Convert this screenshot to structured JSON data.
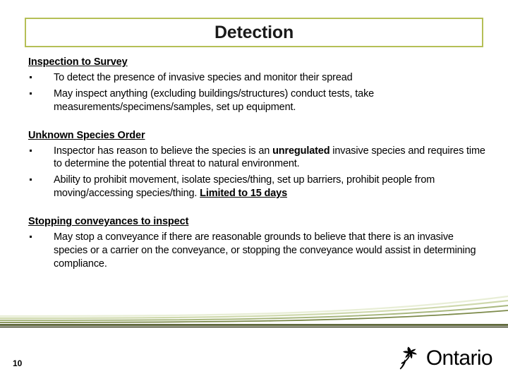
{
  "slide": {
    "title": "Detection",
    "page_number": "10",
    "accent_border_color": "#b5bf56",
    "title_color": "#1a1a1a"
  },
  "sections": [
    {
      "heading": "Inspection to Survey",
      "bullets": [
        {
          "parts": [
            {
              "text": "To detect the presence of invasive species and monitor their spread",
              "style": "normal"
            }
          ]
        },
        {
          "parts": [
            {
              "text": "May inspect anything (excluding buildings/structures) conduct tests, take measurements/specimens/samples, set up equipment.",
              "style": "normal"
            }
          ]
        }
      ]
    },
    {
      "heading": "Unknown Species Order",
      "bullets": [
        {
          "parts": [
            {
              "text": "Inspector has reason to believe the species is an ",
              "style": "normal"
            },
            {
              "text": "unregulated",
              "style": "bold"
            },
            {
              "text": "  invasive species and requires time to determine the  potential  threat to natural environment.",
              "style": "normal"
            }
          ]
        },
        {
          "parts": [
            {
              "text": "Ability to prohibit movement, isolate species/thing, set up barriers, prohibit people from moving/accessing species/thing.  ",
              "style": "normal"
            },
            {
              "text": "Limited to 15 days",
              "style": "bold-underline"
            }
          ]
        }
      ]
    },
    {
      "heading": "Stopping conveyances to inspect",
      "bullets": [
        {
          "parts": [
            {
              "text": "May stop a conveyance if there are reasonable grounds to believe that there is an invasive species or a carrier on the conveyance, or stopping the conveyance would assist in determining compliance.",
              "style": "normal"
            }
          ]
        }
      ]
    }
  ],
  "decoration": {
    "swoosh_colors": [
      "#e8eed6",
      "#cfd9ad",
      "#a8b77e",
      "#7c8a4a",
      "#4a5320",
      "#2b3010"
    ]
  },
  "footer": {
    "logo_name": "Ontario",
    "logo_mark": "trillium-icon"
  }
}
